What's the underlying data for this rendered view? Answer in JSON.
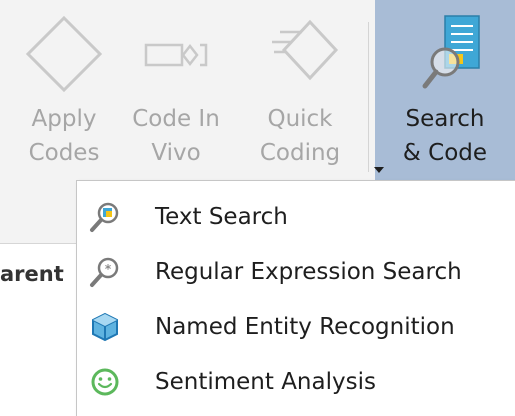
{
  "ribbon": {
    "buttons": [
      {
        "id": "apply-codes",
        "line1": "Apply",
        "line2": "Codes",
        "icon": "diamond-icon"
      },
      {
        "id": "code-in-vivo",
        "line1": "Code In",
        "line2": "Vivo",
        "icon": "code-in-vivo-icon"
      },
      {
        "id": "quick-coding",
        "line1": "Quick",
        "line2": "Coding",
        "icon": "quick-coding-icon"
      },
      {
        "id": "search-code",
        "line1": "Search",
        "line2": "& Code",
        "icon": "search-code-icon"
      }
    ]
  },
  "background": {
    "partial_text": "arent"
  },
  "menu": {
    "items": [
      {
        "label": "Text Search",
        "icon": "text-search-icon"
      },
      {
        "label": "Regular Expression Search",
        "icon": "regex-search-icon"
      },
      {
        "label": "Named Entity Recognition",
        "icon": "cube-icon"
      },
      {
        "label": "Sentiment Analysis",
        "icon": "smiley-icon"
      }
    ]
  },
  "colors": {
    "ribbon_bg": "#f3f3f3",
    "active_button_bg": "#a8bcd6",
    "disabled_text": "#a6a6a6",
    "menu_text": "#1e1e1e"
  }
}
